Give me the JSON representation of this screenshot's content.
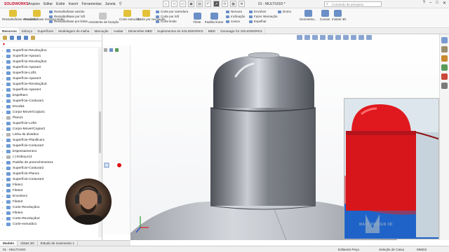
{
  "app": {
    "logo": "SOLIDWORKS",
    "file_name": "01 - MULTIUSO *"
  },
  "menu": [
    "Arquivo",
    "Editar",
    "Exibir",
    "Inserir",
    "Ferramentas",
    "Janela"
  ],
  "search": {
    "placeholder": "Comando de pesquisa"
  },
  "ribbon": {
    "big": [
      {
        "label": "Ressalto/base extrudado",
        "color": "#e3c23a"
      },
      {
        "label": "Ressalto/base revolucionado",
        "color": "#e3c23a"
      },
      {
        "label": "Assistente de furação",
        "color": "#c7c7c7"
      },
      {
        "label": "Corte extrudido",
        "color": "#e3c23a"
      },
      {
        "label": "Corte por revolução",
        "color": "#e3c23a"
      },
      {
        "label": "Filete",
        "color": "#6b8fc7"
      },
      {
        "label": "Padrão linear",
        "color": "#6b8fc7"
      },
      {
        "label": "Geometria...",
        "color": "#6b8fc7"
      },
      {
        "label": "Curvas",
        "color": "#6b8fc7"
      },
      {
        "label": "Instant 3D",
        "color": "#6b8fc7"
      }
    ],
    "small": [
      "Ressalto/base varrido",
      "Ressalto/Base por loft",
      "Ressalto/base por limite",
      "Corte por varredura",
      "Corte por loft",
      "Corte limite",
      "Nervura",
      "Inclinação",
      "Casca",
      "Envolver",
      "Fazer interseção",
      "Espelhar",
      "Domo"
    ]
  },
  "cmd_tabs": [
    "Recursos",
    "Esboço",
    "Superfícies",
    "Modelagem de malha",
    "Marcação",
    "Avaliar",
    "Dimensões MBD",
    "Suplementos do SOLIDWORKS",
    "MBD",
    "Geomagic for SOLIDWORKS"
  ],
  "tree": [
    {
      "label": "Superfície-Revolução1",
      "icon": "surface-icon"
    },
    {
      "label": "Superfície-Aparar1",
      "icon": "surface-icon"
    },
    {
      "label": "Superfície-Revolução2",
      "icon": "surface-icon"
    },
    {
      "label": "Superfície-Aparar2",
      "icon": "surface-icon"
    },
    {
      "label": "Superfície-Loft1",
      "icon": "surface-icon"
    },
    {
      "label": "Superfície-Aparar3",
      "icon": "surface-icon"
    },
    {
      "label": "Superfície-Revolução3",
      "icon": "surface-icon"
    },
    {
      "label": "Superfície-Aparar4",
      "icon": "surface-icon"
    },
    {
      "label": "Espelhar1",
      "icon": "mirror-icon"
    },
    {
      "label": "Superfície-Costurar1",
      "icon": "surface-icon"
    },
    {
      "label": "Escala1",
      "icon": "scale-icon"
    },
    {
      "label": "Corpo-Mover/Copiar1",
      "icon": "move-icon"
    },
    {
      "label": "Plano1",
      "icon": "plane-icon"
    },
    {
      "label": "Superfície-Loft3",
      "icon": "surface-icon"
    },
    {
      "label": "Corpo-Mover/Copiar2",
      "icon": "move-icon"
    },
    {
      "label": "Linha de divisão1",
      "icon": "split-line-icon"
    },
    {
      "label": "Superfície-Planificar1",
      "icon": "surface-icon"
    },
    {
      "label": "Superfície-Costurar2",
      "icon": "surface-icon"
    },
    {
      "label": "Espessamento1",
      "icon": "thicken-icon"
    },
    {
      "label": "(-) Esboço13",
      "icon": "sketch-icon"
    },
    {
      "label": "Padrão de preenchimento1",
      "icon": "pattern-icon"
    },
    {
      "label": "Superfície-Costurar2",
      "icon": "surface-icon"
    },
    {
      "label": "Superfície-Plano1",
      "icon": "surface-icon"
    },
    {
      "label": "Superfície-Costurar3",
      "icon": "surface-icon"
    },
    {
      "label": "Filete1",
      "icon": "fillet-icon"
    },
    {
      "label": "Filete2",
      "icon": "fillet-icon"
    },
    {
      "label": "Envolver1",
      "icon": "wrap-icon"
    },
    {
      "label": "Filete3",
      "icon": "fillet-icon"
    },
    {
      "label": "Corte-Revolução1",
      "icon": "cut-icon"
    },
    {
      "label": "Filete4",
      "icon": "fillet-icon"
    },
    {
      "label": "Corte-Revolução2",
      "icon": "cut-icon"
    },
    {
      "label": "Corte-extrusão1",
      "icon": "cut-icon"
    }
  ],
  "bottom_tabs": [
    "Modelo",
    "Vistas 3D",
    "Estudo de movimento 1"
  ],
  "status": {
    "left": "01 - MULTIUSO",
    "mid": "Editando Peça",
    "selection": "Seleção de Caixa",
    "units": "MMGS"
  },
  "watermark": "MAIS DESIGN 3D",
  "colors": {
    "accent": "#c8102e",
    "body": "#7d8088",
    "inset_red": "#d6161b",
    "inset_blue": "#1f63c8"
  }
}
